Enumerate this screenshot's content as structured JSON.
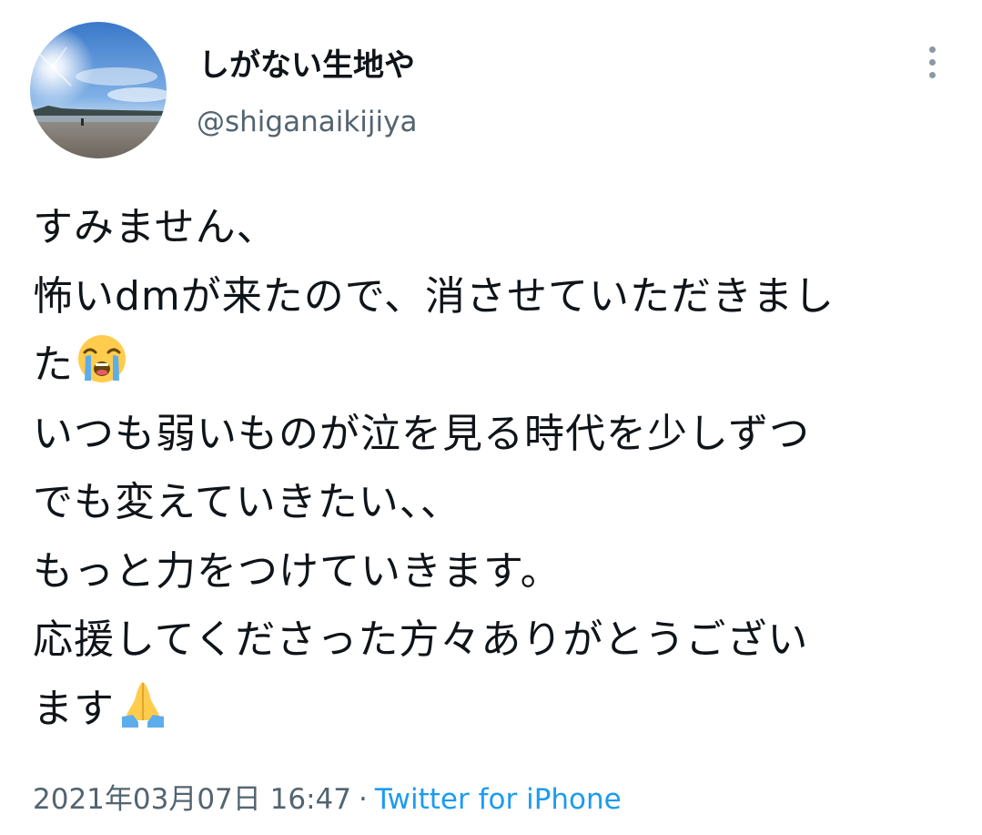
{
  "author": {
    "display_name": "しがない生地や",
    "handle": "@shiganaikijiya",
    "avatar_icon": "beach-sky-photo-avatar"
  },
  "menu": {
    "icon": "more-vertical-icon"
  },
  "tweet": {
    "lines": [
      "すみません、",
      "怖いdmが来たので、消させていただきまし",
      "た",
      "いつも弱いものが泣を見る時代を少しずつ",
      "でも変えていきたい、、",
      "もっと力をつけていきます。",
      "応援してくださった方々ありがとうござい",
      "ます"
    ],
    "emojis": {
      "line_3": "loudly-crying-face-emoji",
      "line_8": "folded-hands-emoji"
    }
  },
  "meta": {
    "timestamp": "2021年03月07日 16:47",
    "separator": "·",
    "source": "Twitter for iPhone"
  },
  "colors": {
    "text": "#0f1419",
    "secondary": "#536471",
    "link": "#1d9bf0"
  }
}
